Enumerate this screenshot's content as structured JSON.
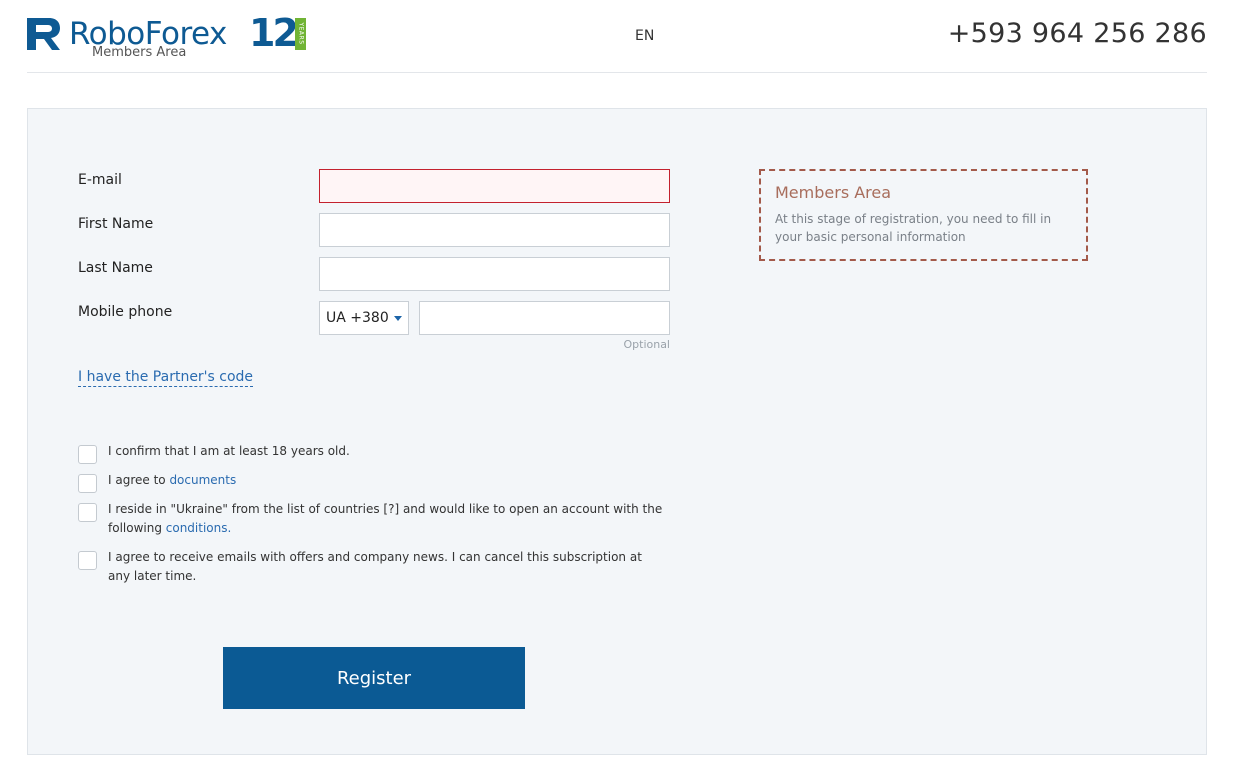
{
  "header": {
    "brand": "RoboForex",
    "years": "12",
    "years_tag": "YEARS",
    "subtitle": "Members Area",
    "language": "EN",
    "phone": "+593 964 256 286"
  },
  "form": {
    "email_label": "E-mail",
    "first_name_label": "First Name",
    "last_name_label": "Last Name",
    "mobile_label": "Mobile phone",
    "country_code": "UA +380",
    "optional_hint": "Optional",
    "partner_link": "I have the Partner's code"
  },
  "checks": [
    {
      "text": "I confirm that I am at least 18 years old."
    },
    {
      "text": "I agree to ",
      "link": "documents"
    },
    {
      "text_before": "I reside in \"Ukraine\" from the list of countries ",
      "bracket": "[?]",
      "text_after": " and would like to open an account with the following ",
      "link": "conditions",
      "end": "."
    },
    {
      "text": "I agree to receive emails with offers and company news. I can cancel this subscription at any later time."
    }
  ],
  "register_label": "Register",
  "info": {
    "title": "Members Area",
    "text": "At this stage of registration, you need to fill in your basic personal information"
  },
  "colors": {
    "brand_blue": "#0b5a94",
    "link_blue": "#2a6bb0",
    "error_red": "#c3212e",
    "accent_green": "#71b435",
    "info_border": "#a35a4a"
  }
}
